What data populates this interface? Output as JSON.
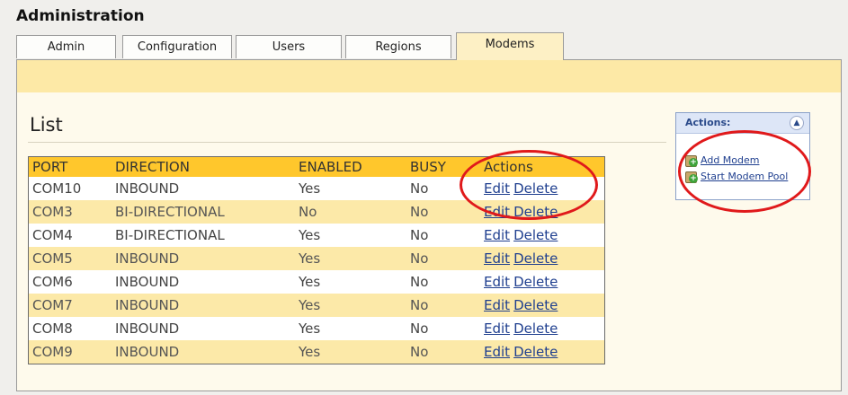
{
  "header": {
    "title": "Administration"
  },
  "tabs": [
    {
      "label": "Admin"
    },
    {
      "label": "Configuration"
    },
    {
      "label": "Users"
    },
    {
      "label": "Regions"
    },
    {
      "label": "Modems"
    }
  ],
  "active_tab": "Modems",
  "list": {
    "heading": "List",
    "columns": [
      "PORT",
      "DIRECTION",
      "ENABLED",
      "BUSY",
      "Actions"
    ],
    "rows": [
      {
        "port": "COM10",
        "direction": "INBOUND",
        "enabled": "Yes",
        "busy": "No",
        "edit": "Edit",
        "delete": "Delete"
      },
      {
        "port": "COM3",
        "direction": "BI-DIRECTIONAL",
        "enabled": "No",
        "busy": "No",
        "edit": "Edit",
        "delete": "Delete"
      },
      {
        "port": "COM4",
        "direction": "BI-DIRECTIONAL",
        "enabled": "Yes",
        "busy": "No",
        "edit": "Edit",
        "delete": "Delete"
      },
      {
        "port": "COM5",
        "direction": "INBOUND",
        "enabled": "Yes",
        "busy": "No",
        "edit": "Edit",
        "delete": "Delete"
      },
      {
        "port": "COM6",
        "direction": "INBOUND",
        "enabled": "Yes",
        "busy": "No",
        "edit": "Edit",
        "delete": "Delete"
      },
      {
        "port": "COM7",
        "direction": "INBOUND",
        "enabled": "Yes",
        "busy": "No",
        "edit": "Edit",
        "delete": "Delete"
      },
      {
        "port": "COM8",
        "direction": "INBOUND",
        "enabled": "Yes",
        "busy": "No",
        "edit": "Edit",
        "delete": "Delete"
      },
      {
        "port": "COM9",
        "direction": "INBOUND",
        "enabled": "Yes",
        "busy": "No",
        "edit": "Edit",
        "delete": "Delete"
      }
    ]
  },
  "actions_panel": {
    "title": "Actions:",
    "collapse_icon": "double-chevron-up-icon",
    "items": [
      {
        "label": "Add Modem",
        "icon": "add-gear-icon"
      },
      {
        "label": "Start Modem Pool",
        "icon": "add-gear-icon"
      }
    ]
  },
  "colors": {
    "accent_header": "#ffc72c",
    "alt_row": "#fce9a8",
    "panel_strip": "#fde9a6",
    "link": "#1f3f8f",
    "annotation_circle": "#e0191b"
  }
}
